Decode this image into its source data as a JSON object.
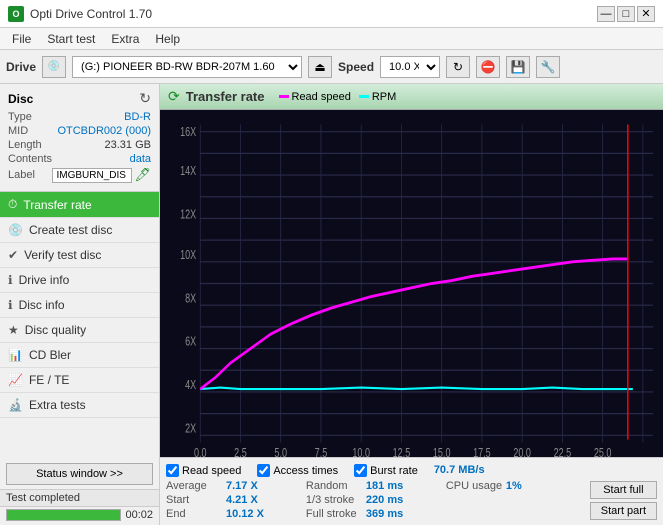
{
  "titlebar": {
    "title": "Opti Drive Control 1.70",
    "minimize": "—",
    "maximize": "□",
    "close": "✕"
  },
  "menubar": {
    "items": [
      "File",
      "Start test",
      "Extra",
      "Help"
    ]
  },
  "drivebar": {
    "drive_label": "Drive",
    "drive_value": "(G:) PIONEER BD-RW  BDR-207M 1.60",
    "speed_label": "Speed",
    "speed_value": "10.0 X ↓"
  },
  "disc": {
    "header": "Disc",
    "type_label": "Type",
    "type_value": "BD-R",
    "mid_label": "MID",
    "mid_value": "OTCBDR002 (000)",
    "length_label": "Length",
    "length_value": "23.31 GB",
    "contents_label": "Contents",
    "contents_value": "data",
    "label_label": "Label",
    "label_value": "IMGBURN_DIS"
  },
  "nav": {
    "items": [
      {
        "label": "Transfer rate",
        "active": true
      },
      {
        "label": "Create test disc",
        "active": false
      },
      {
        "label": "Verify test disc",
        "active": false
      },
      {
        "label": "Drive info",
        "active": false
      },
      {
        "label": "Disc info",
        "active": false
      },
      {
        "label": "Disc quality",
        "active": false
      },
      {
        "label": "CD Bler",
        "active": false
      },
      {
        "label": "FE / TE",
        "active": false
      },
      {
        "label": "Extra tests",
        "active": false
      }
    ],
    "status_btn": "Status window >>"
  },
  "chart": {
    "title": "Transfer rate",
    "legend": [
      {
        "label": "Read speed",
        "color": "#ff00ff"
      },
      {
        "label": "RPM",
        "color": "#00ffff"
      }
    ],
    "y_axis": [
      "16X",
      "14X",
      "12X",
      "10X",
      "8X",
      "6X",
      "4X",
      "2X"
    ],
    "x_axis": [
      "0.0",
      "2.5",
      "5.0",
      "7.5",
      "10.0",
      "12.5",
      "15.0",
      "17.5",
      "20.0",
      "22.5",
      "25.0"
    ],
    "burst_value": "70.7 MB/s"
  },
  "stats": {
    "checkboxes": [
      {
        "label": "Read speed",
        "checked": true
      },
      {
        "label": "Access times",
        "checked": true
      },
      {
        "label": "Burst rate",
        "checked": true,
        "value": "70.7 MB/s"
      }
    ],
    "rows": [
      {
        "label": "Average",
        "value": "7.17 X",
        "label2": "Random",
        "value2": "181 ms",
        "label3": "CPU usage",
        "value3": "1%"
      },
      {
        "label": "Start",
        "value": "4.21 X",
        "label2": "1/3 stroke",
        "value2": "220 ms",
        "btn": "Start full"
      },
      {
        "label": "End",
        "value": "10.12 X",
        "label2": "Full stroke",
        "value2": "369 ms",
        "btn": "Start part"
      }
    ]
  },
  "statusbar": {
    "completed_text": "Test completed",
    "progress": 100,
    "time": "00:02"
  }
}
